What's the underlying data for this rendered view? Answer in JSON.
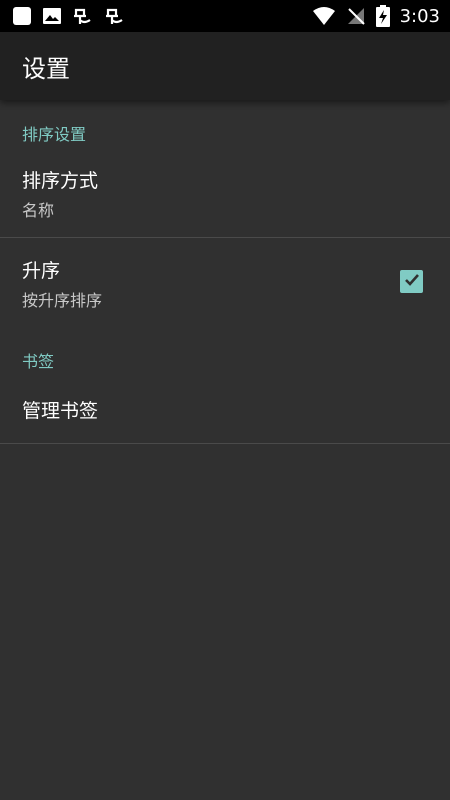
{
  "status_bar": {
    "time": "3:03",
    "left_icons": [
      "app-square-icon",
      "image-icon",
      "bug-icon",
      "bug-icon"
    ],
    "right_icons": [
      "wifi-icon",
      "no-signal-icon",
      "battery-charging-icon"
    ]
  },
  "toolbar": {
    "title": "设置"
  },
  "sections": [
    {
      "category": "排序设置",
      "prefs": [
        {
          "title": "排序方式",
          "summary": "名称"
        },
        {
          "title": "升序",
          "summary": "按升序排序",
          "checkbox": true,
          "checked": true
        }
      ]
    },
    {
      "category": "书签",
      "prefs": [
        {
          "title": "管理书签"
        }
      ]
    }
  ],
  "colors": {
    "accent": "#80cbc4",
    "background": "#303030",
    "toolbar": "#212121",
    "status_bar": "#000000"
  }
}
